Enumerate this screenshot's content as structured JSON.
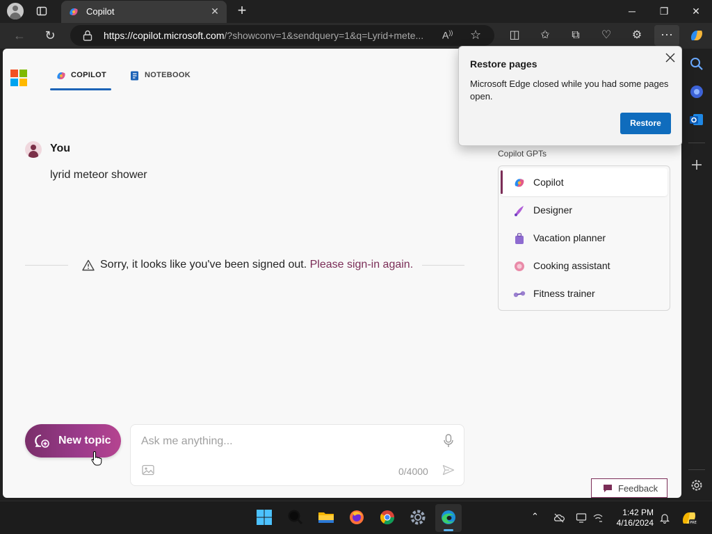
{
  "browser": {
    "tab": {
      "title": "Copilot"
    },
    "address": {
      "url_host": "https://copilot.microsoft.com",
      "url_rest": "/?showconv=1&sendquery=1&q=Lyrid+mete..."
    }
  },
  "header": {
    "tabs": [
      {
        "label": "COPILOT",
        "active": true
      },
      {
        "label": "NOTEBOOK",
        "active": false
      }
    ]
  },
  "conversation": {
    "author": "You",
    "message": "lyrid meteor shower"
  },
  "notice": {
    "text": "Sorry, it looks like you've been signed out.",
    "link": "Please sign-in again."
  },
  "gpts": {
    "title": "Copilot GPTs",
    "items": [
      {
        "label": "Copilot",
        "icon": "copilot-icon",
        "active": true
      },
      {
        "label": "Designer",
        "icon": "designer-icon"
      },
      {
        "label": "Vacation planner",
        "icon": "suitcase-icon"
      },
      {
        "label": "Cooking assistant",
        "icon": "cooking-icon"
      },
      {
        "label": "Fitness trainer",
        "icon": "dumbbell-icon"
      }
    ]
  },
  "composer": {
    "new_topic_label": "New topic",
    "placeholder": "Ask me anything...",
    "counter": "0/4000"
  },
  "feedback": {
    "label": "Feedback"
  },
  "popup": {
    "title": "Restore pages",
    "message": "Microsoft Edge closed while you had some pages open.",
    "button": "Restore"
  },
  "taskbar": {
    "time": "1:42 PM",
    "date": "4/16/2024"
  },
  "colors": {
    "accent": "#7b2d57",
    "link": "#1c63b7",
    "restore_button": "#0f6cbd"
  }
}
